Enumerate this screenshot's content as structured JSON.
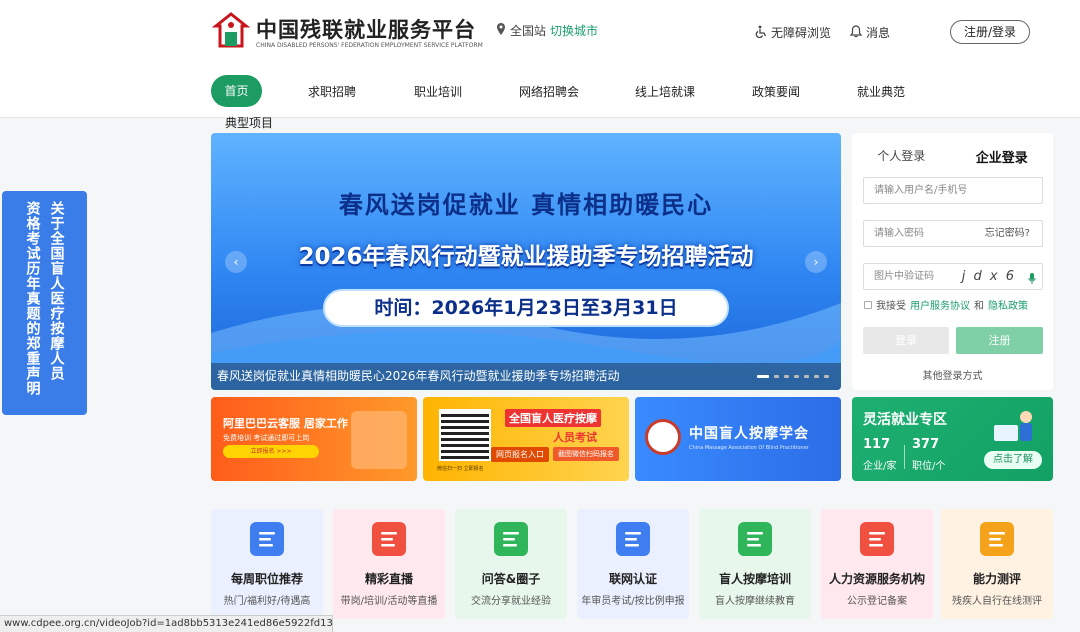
{
  "header": {
    "logo_title": "中国残联就业服务平台",
    "logo_subtitle": "CHINA DISABLED PERSONS' FEDERATION EMPLOYMENT SERVICE PLATFORM",
    "site_label": "全国站",
    "switch_city": "切换城市",
    "accessibility": "无障碍浏览",
    "messages": "消息",
    "register_login": "注册/登录",
    "brand_color": "#1c9b62"
  },
  "nav": {
    "items": [
      {
        "label": "首页"
      },
      {
        "label": "求职招聘"
      },
      {
        "label": "职业培训"
      },
      {
        "label": "网络招聘会"
      },
      {
        "label": "线上培就课"
      },
      {
        "label": "政策要闻"
      },
      {
        "label": "就业典范"
      }
    ],
    "sub_item": "典型项目"
  },
  "side_notice": {
    "lines": [
      "关于全国盲人医疗按摩人员",
      "资格考试历年真题的郑重声明"
    ]
  },
  "banner": {
    "line1": "春风送岗促就业  真情相助暖民心",
    "line2": "2026年春风行动暨就业援助季专场招聘活动",
    "line3": "时间：2026年1月23日至3月31日",
    "caption": "春风送岗促就业真情相助暖民心2026年春风行动暨就业援助季专场招聘活动"
  },
  "login": {
    "tab_personal": "个人登录",
    "tab_company": "企业登录",
    "username_placeholder": "请输入用户名/手机号",
    "password_placeholder": "请输入密码",
    "forgot": "忘记密码?",
    "captcha_placeholder": "图片中验证码",
    "captcha_text": "j d x 6",
    "agree_prefix": "我接受",
    "agree_link1": "用户服务协议",
    "agree_and": "和",
    "agree_link2": "隐私政策",
    "login_btn": "登录",
    "register_btn": "注册",
    "other_login": "其他登录方式"
  },
  "promos": {
    "alibaba": {
      "title": "阿里巴巴云客服 居家工作",
      "sub": "免费培训  考试通过即可上岗",
      "btn": "立即报名 >>>"
    },
    "massage_exam": {
      "title": "全国盲人医疗按摩",
      "title2": "人员考试",
      "btn1": "网页报名入口",
      "btn2": "截图微信扫码报名",
      "qr_caption": "微信扫一扫  立即报名"
    },
    "association": {
      "title": "中国盲人按摩学会",
      "sub": "China Massage Association Of Blind Practitioner"
    }
  },
  "flex_zone": {
    "title": "灵活就业专区",
    "companies_value": "117",
    "companies_label": "企业/家",
    "jobs_value": "377",
    "jobs_label": "职位/个",
    "btn": "点击了解"
  },
  "service_cards": [
    {
      "title": "每周职位推荐",
      "sub": "热门/福利好/待遇高",
      "bg": "#eaf0ff",
      "icon": "#3f7ef0",
      "icon_name": "job-list-icon"
    },
    {
      "title": "精彩直播",
      "sub": "带岗/培训/活动等直播",
      "bg": "#ffe9ee",
      "icon": "#f0503f",
      "icon_name": "live-play-icon"
    },
    {
      "title": "问答&圈子",
      "sub": "交流分享就业经验",
      "bg": "#e8f7ec",
      "icon": "#2fb55a",
      "icon_name": "qa-icon"
    },
    {
      "title": "联网认证",
      "sub": "年审员考试/按比例申报",
      "bg": "#eaf0ff",
      "icon": "#3f7ef0",
      "icon_name": "certification-icon"
    },
    {
      "title": "盲人按摩培训",
      "sub": "盲人按摩继续教育",
      "bg": "#e8f7ec",
      "icon": "#2fb55a",
      "icon_name": "training-icon"
    },
    {
      "title": "人力资源服务机构",
      "sub": "公示登记备案",
      "bg": "#ffe9ee",
      "icon": "#f0503f",
      "icon_name": "hr-agency-icon"
    },
    {
      "title": "能力测评",
      "sub": "残疾人自行在线测评",
      "bg": "#fff2e2",
      "icon": "#f5a21b",
      "icon_name": "assessment-icon"
    }
  ],
  "status_url": "www.cdpee.org.cn/videoJob?id=1ad8bb5313e241ed86e5922fd1395e09"
}
